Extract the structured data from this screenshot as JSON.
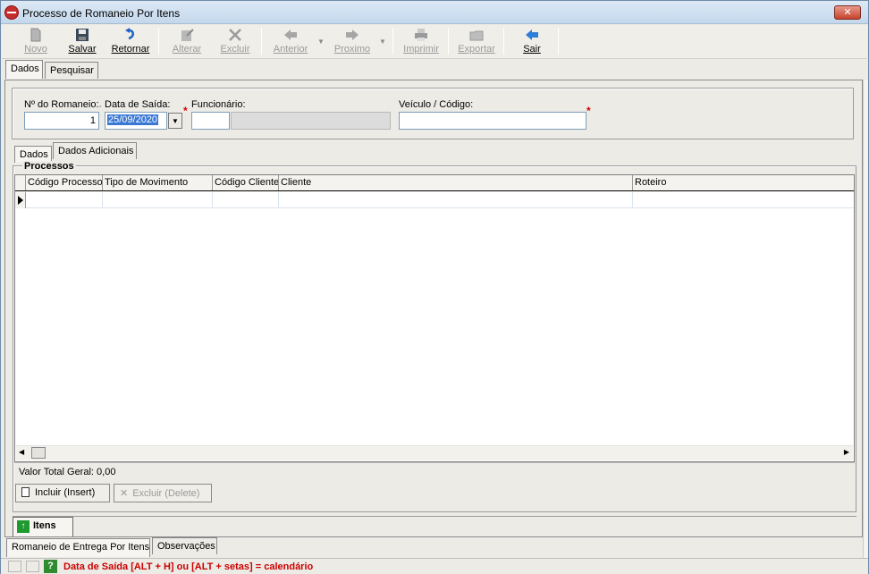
{
  "window": {
    "title": "Processo de Romaneio Por Itens",
    "close_label": "✕"
  },
  "toolbar": {
    "novo": "Novo",
    "salvar": "Salvar",
    "retornar": "Retornar",
    "alterar": "Alterar",
    "excluir": "Excluir",
    "anterior": "Anterior",
    "proximo": "Proximo",
    "imprimir": "Imprimir",
    "exportar": "Exportar",
    "sair": "Sair"
  },
  "main_tabs": [
    "Dados",
    "Pesquisar"
  ],
  "form": {
    "romaneio_label": "Nº do Romaneio:",
    "romaneio_value": "1",
    "data_saida_label": "Data de Saída:",
    "data_saida_value": "25/09/2020",
    "funcionario_label": "Funcionário:",
    "funcionario_code": "",
    "funcionario_name": "",
    "veiculo_label": "Veículo / Código:",
    "veiculo_value": "",
    "required_mark": "*"
  },
  "sub_tabs": [
    "Dados",
    "Dados Adicionais"
  ],
  "processos": {
    "title": "Processos",
    "columns": [
      "Código Processo",
      "Tipo de Movimento",
      "Código Cliente",
      "Cliente",
      "Roteiro"
    ],
    "total_label": "Valor Total Geral: 0,00"
  },
  "actions": {
    "incluir": "Incluir (Insert)",
    "excluir": "Excluir (Delete)"
  },
  "itens_tab": "Itens",
  "bottom_tabs": [
    "Romaneio de Entrega Por Itens",
    "Observações"
  ],
  "status": {
    "hint": "Data de Saída [ALT + H] ou [ALT + setas] = calendário",
    "help_icon": "?"
  },
  "colors": {
    "required": "#d40000",
    "status_text": "#cc0000",
    "accent": "#3a78d4"
  }
}
